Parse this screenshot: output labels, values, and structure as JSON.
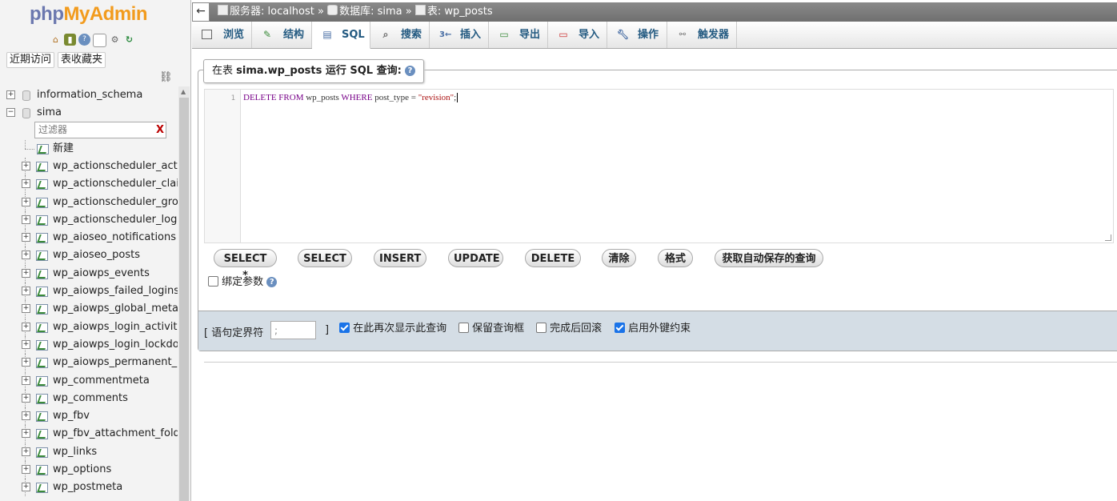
{
  "nav": {
    "logo_php": "php",
    "logo_myadmin": "MyAdmin",
    "recent_label": "近期访问",
    "favorites_label": "表收藏夹",
    "filter_placeholder": "过滤器",
    "filter_clear": "X",
    "databases": [
      "information_schema",
      "sima"
    ],
    "new_label": "新建",
    "tables": [
      "wp_actionscheduler_actions",
      "wp_actionscheduler_claims",
      "wp_actionscheduler_groups",
      "wp_actionscheduler_logs",
      "wp_aioseo_notifications",
      "wp_aioseo_posts",
      "wp_aiowps_events",
      "wp_aiowps_failed_logins",
      "wp_aiowps_global_meta",
      "wp_aiowps_login_activity",
      "wp_aiowps_login_lockdown",
      "wp_aiowps_permanent_block",
      "wp_commentmeta",
      "wp_comments",
      "wp_fbv",
      "wp_fbv_attachment_folder",
      "wp_links",
      "wp_options",
      "wp_postmeta"
    ]
  },
  "breadcrumb": {
    "server": "服务器: localhost",
    "sep": "»",
    "database": "数据库: sima",
    "table": "表: wp_posts"
  },
  "tabs": [
    {
      "label": "浏览",
      "icon": "browse-icon"
    },
    {
      "label": "结构",
      "icon": "structure-icon"
    },
    {
      "label": "SQL",
      "icon": "sql-icon"
    },
    {
      "label": "搜索",
      "icon": "search-icon"
    },
    {
      "label": "插入",
      "icon": "insert-icon"
    },
    {
      "label": "导出",
      "icon": "export-icon"
    },
    {
      "label": "导入",
      "icon": "import-icon"
    },
    {
      "label": "操作",
      "icon": "operations-icon"
    },
    {
      "label": "触发器",
      "icon": "triggers-icon"
    }
  ],
  "active_tab": "SQL",
  "query_box": {
    "legend_prefix": "在表 ",
    "legend_table": "sima.wp_posts",
    "legend_suffix": " 运行 SQL 查询:",
    "line_number": "1",
    "code": {
      "k1": "DELETE",
      "k2": "FROM",
      "t1": " wp_posts ",
      "k3": "WHERE",
      "t2": " post_type = ",
      "s1": "\"revision\"",
      "t3": ";"
    }
  },
  "buttons": [
    "SELECT *",
    "SELECT",
    "INSERT",
    "UPDATE",
    "DELETE",
    "清除",
    "格式",
    "获取自动保存的查询"
  ],
  "bind_params_label": "绑定参数",
  "options": {
    "delimiter_label": "[ 语句定界符",
    "delimiter_value": ";",
    "delimiter_close": "]",
    "show_query_label": "在此再次显示此查询",
    "retain_box_label": "保留查询框",
    "rollback_label": "完成后回滚",
    "foreign_keys_label": "启用外键约束"
  },
  "checkbox_states": {
    "bind_params": false,
    "show_query": true,
    "retain_box": false,
    "rollback": false,
    "foreign_keys": true
  }
}
